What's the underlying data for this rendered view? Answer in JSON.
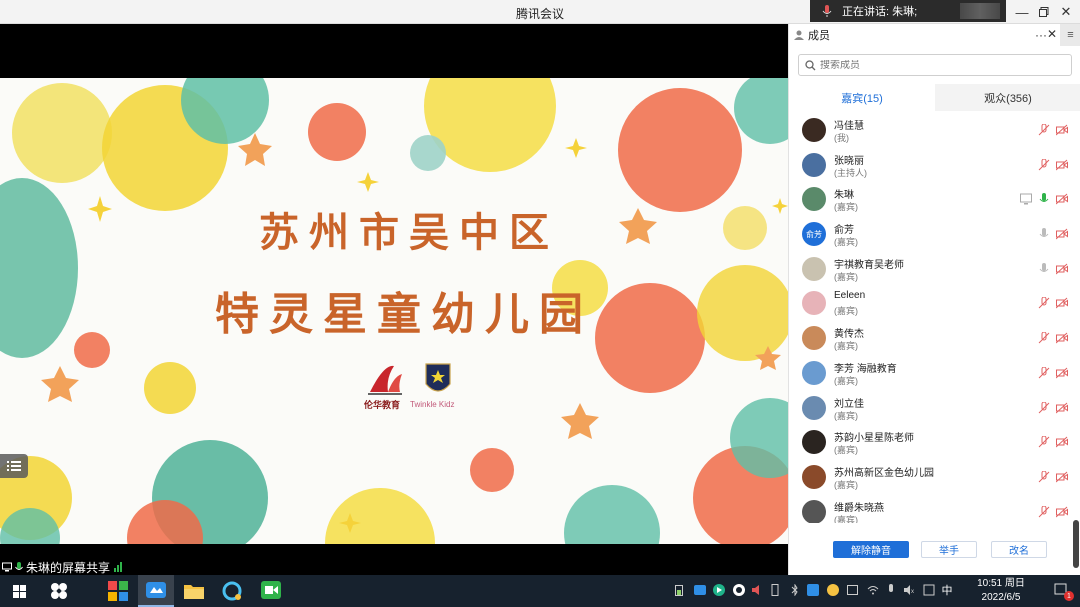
{
  "window": {
    "title": "腾讯会议"
  },
  "speaking": {
    "text": "正在讲话: 朱琳;"
  },
  "slide": {
    "line1": "苏州市吴中区",
    "line2": "特灵星童幼儿园",
    "logo_left_text": "伦华教育",
    "logo_right_text": "Twinkle Kidz"
  },
  "share": {
    "label": "朱琳的屏幕共享"
  },
  "panel": {
    "title": "成员",
    "search_placeholder": "搜索成员",
    "tabs": [
      {
        "label": "嘉宾(15)",
        "active": true
      },
      {
        "label": "观众(356)",
        "active": false
      }
    ],
    "members": [
      {
        "name": "冯佳慧",
        "role": "(我)",
        "avatar_color": "#3a2a22"
      },
      {
        "name": "张晓丽",
        "role": "(主持人)",
        "avatar_color": "#4a6fa0"
      },
      {
        "name": "朱琳",
        "role": "(嘉宾)",
        "avatar_color": "#5a8a6a"
      },
      {
        "name": "俞芳",
        "role": "(嘉宾)",
        "avatar_color": "#1f6fd8",
        "avatar_text": "俞芳"
      },
      {
        "name": "宇祺教育吴老师",
        "role": "(嘉宾)",
        "avatar_color": "#c9c2b0"
      },
      {
        "name": "Eeleen",
        "role": "(嘉宾)",
        "avatar_color": "#e7b3b8"
      },
      {
        "name": "黄传杰",
        "role": "(嘉宾)",
        "avatar_color": "#c98a5a"
      },
      {
        "name": "李芳 海融教育",
        "role": "(嘉宾)",
        "avatar_color": "#6a9bd0"
      },
      {
        "name": "刘立佳",
        "role": "(嘉宾)",
        "avatar_color": "#6a8bb0"
      },
      {
        "name": "苏韵小星星陈老师",
        "role": "(嘉宾)",
        "avatar_color": "#2a2420"
      },
      {
        "name": "苏州高新区金色幼儿园",
        "role": "(嘉宾)",
        "avatar_color": "#8a4a2a"
      },
      {
        "name": "维爵朱晓燕",
        "role": "(嘉宾)",
        "avatar_color": "#555555"
      }
    ],
    "buttons": {
      "unmute_all": "解除静音",
      "raise_hand": "举手",
      "rename": "改名"
    }
  },
  "taskbar": {
    "ime": "中",
    "time": "10:51 周日",
    "date": "2022/6/5",
    "notification_count": "1"
  },
  "colors": {
    "accent": "#1f6fd8",
    "slide_text": "#c9642a",
    "muted_red": "#e06060",
    "mic_green": "#2fb34a"
  }
}
